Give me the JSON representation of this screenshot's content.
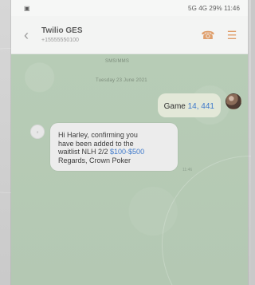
{
  "status_bar": {
    "left_icon": "image",
    "right_text": "5G 4G 29% 11:46"
  },
  "header": {
    "contact_name": "Twilio GES",
    "contact_number": "+15555550100"
  },
  "chat": {
    "system_label": "SMS/MMS",
    "date_label": "Tuesday 23 June 2021",
    "outgoing_message_prefix": "Game ",
    "outgoing_message_amount": "14, 441",
    "incoming_lines": [
      "Hi Harley, confirming you",
      "have been added to the",
      "waitlist NLH 2/2 $100-$500",
      "Regards, Crown Poker"
    ],
    "incoming_time": "11:46"
  },
  "colors": {
    "accent": "#3d78ca",
    "header_icons": "#df9f6c",
    "chat_background": "#b7ccb6"
  }
}
